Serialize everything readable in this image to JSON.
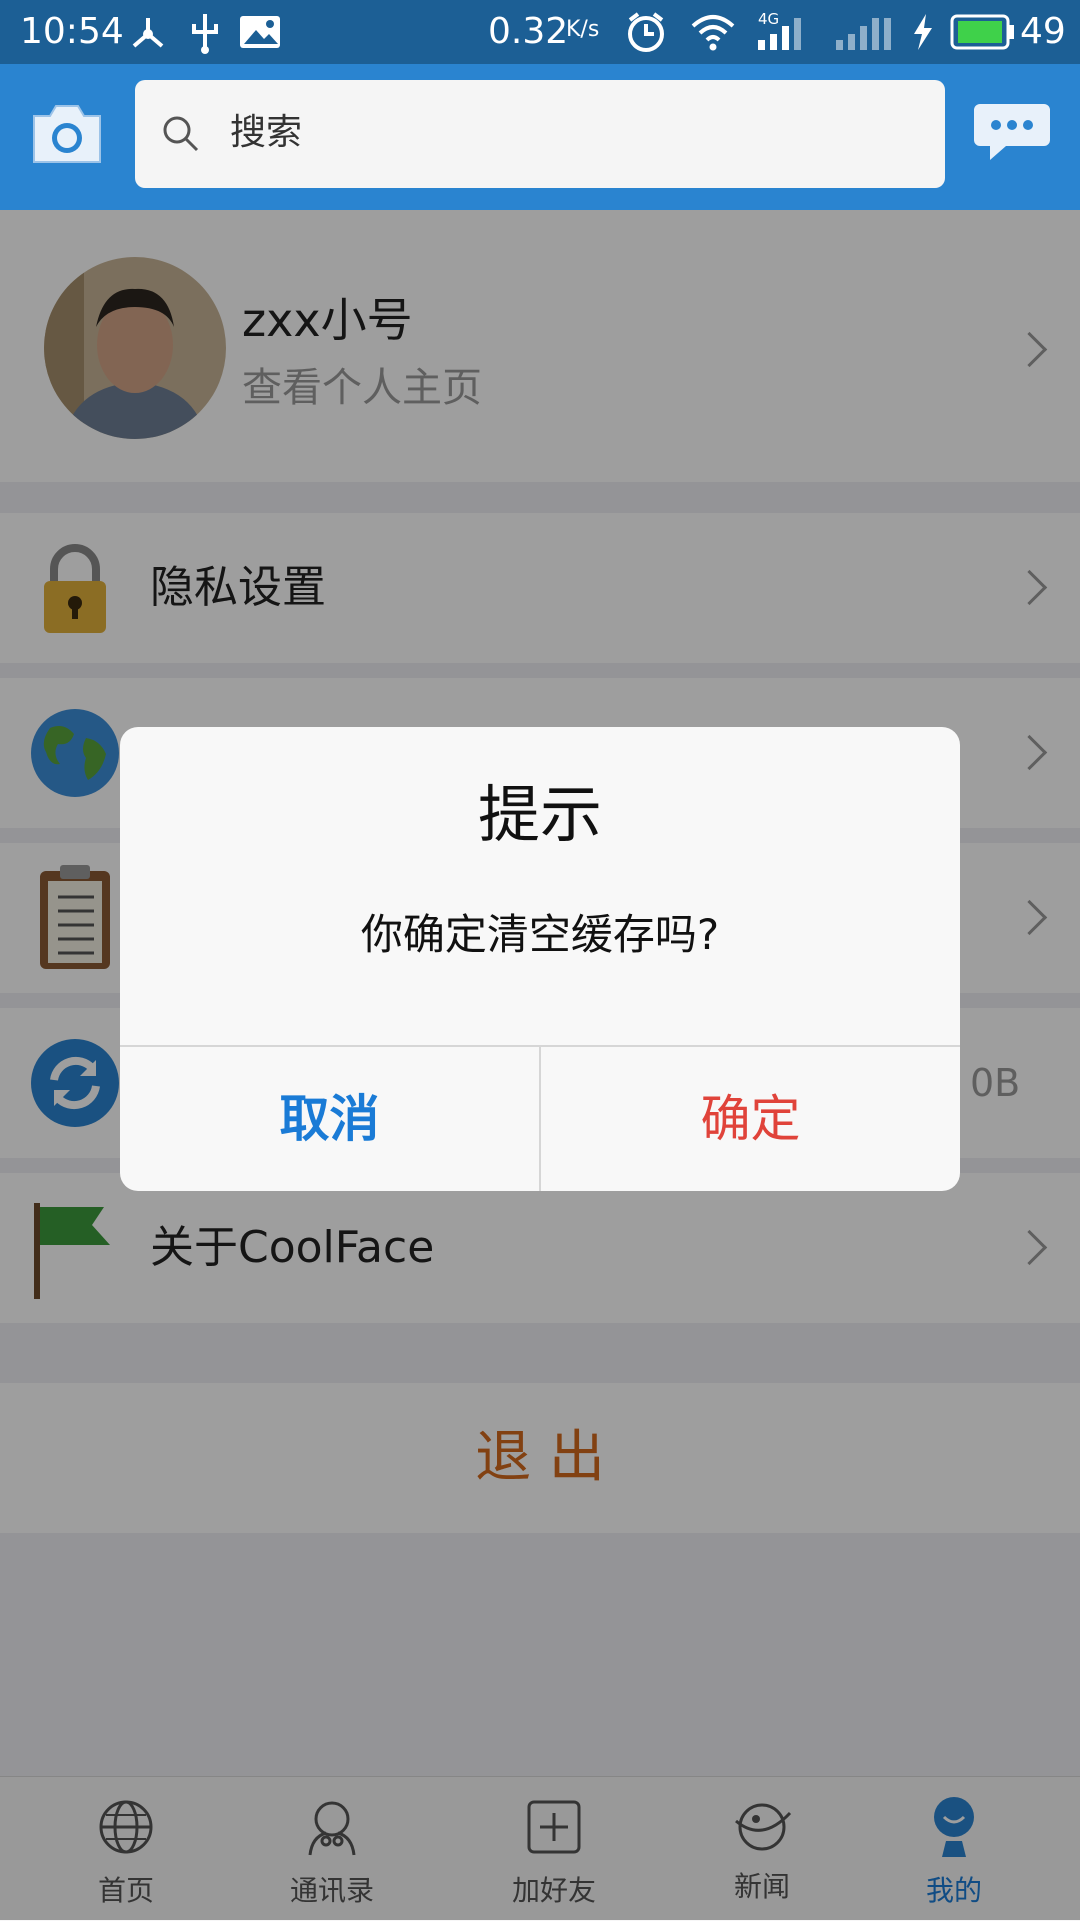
{
  "status_bar": {
    "time": "10:54",
    "speed": "0.32",
    "speed_unit": "K/s",
    "network": "4G",
    "battery": "49"
  },
  "header": {
    "search_placeholder": "搜索",
    "camera_icon": "camera-icon",
    "message_icon": "message-icon"
  },
  "profile": {
    "name": "zxx小号",
    "subtitle": "查看个人主页"
  },
  "menu": {
    "privacy": "隐私设置",
    "cache_size": "0B",
    "about": "关于CoolFace"
  },
  "logout": {
    "label": "退 出"
  },
  "tabs": [
    {
      "label": "首页",
      "icon": "globe-icon"
    },
    {
      "label": "通讯录",
      "icon": "contacts-icon"
    },
    {
      "label": "加好友",
      "icon": "add-friend-icon"
    },
    {
      "label": "新闻",
      "icon": "news-icon"
    },
    {
      "label": "我的",
      "icon": "profile-icon",
      "active": true
    }
  ],
  "dialog": {
    "title": "提示",
    "message": "你确定清空缓存吗?",
    "cancel": "取消",
    "confirm": "确定"
  },
  "colors": {
    "header": "#2a84d0",
    "accent_blue": "#1a7bd6",
    "confirm_red": "#e0433a",
    "logout_orange": "#d2691e"
  }
}
